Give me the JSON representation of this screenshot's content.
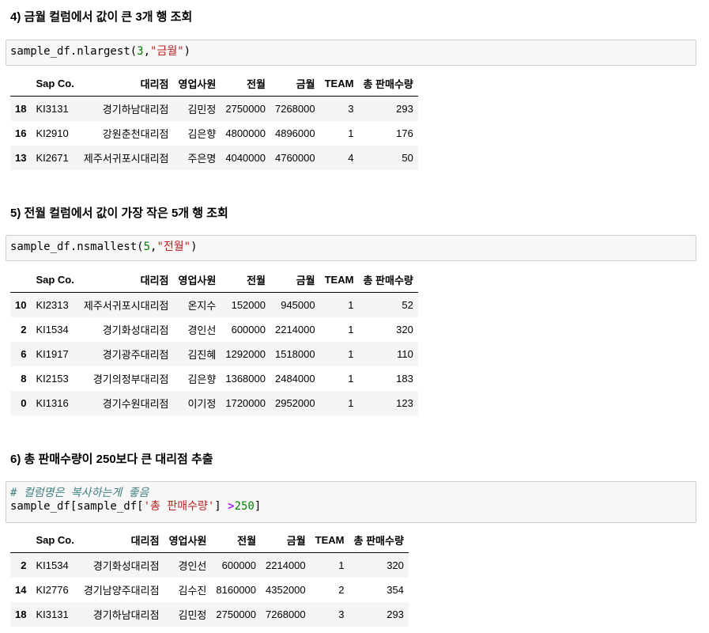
{
  "columns": [
    "",
    "Sap Co.",
    "대리점",
    "영업사원",
    "전월",
    "금월",
    "TEAM",
    "총 판매수량"
  ],
  "sections": [
    {
      "heading": "4) 금월 컬럼에서 값이 큰 3개 행 조회",
      "code": {
        "fn": "sample_df.nlargest(",
        "num": "3",
        "sep": ",",
        "str": "\"금월\"",
        "end": ")"
      },
      "rows": [
        [
          "18",
          "KI3131",
          "경기하남대리점",
          "김민정",
          "2750000",
          "7268000",
          "3",
          "293"
        ],
        [
          "16",
          "KI2910",
          "강원춘천대리점",
          "김은향",
          "4800000",
          "4896000",
          "1",
          "176"
        ],
        [
          "13",
          "KI2671",
          "제주서귀포시대리점",
          "주은명",
          "4040000",
          "4760000",
          "4",
          "50"
        ]
      ]
    },
    {
      "heading": "5) 전월 컬럼에서 값이 가장 작은 5개 행 조회",
      "code": {
        "fn": "sample_df.nsmallest(",
        "num": "5",
        "sep": ",",
        "str": "\"전월\"",
        "end": ")"
      },
      "rows": [
        [
          "10",
          "KI2313",
          "제주서귀포시대리점",
          "온지수",
          "152000",
          "945000",
          "1",
          "52"
        ],
        [
          "2",
          "KI1534",
          "경기화성대리점",
          "경인선",
          "600000",
          "2214000",
          "1",
          "320"
        ],
        [
          "6",
          "KI1917",
          "경기광주대리점",
          "김진혜",
          "1292000",
          "1518000",
          "1",
          "110"
        ],
        [
          "8",
          "KI2153",
          "경기의정부대리점",
          "김은향",
          "1368000",
          "2484000",
          "1",
          "183"
        ],
        [
          "0",
          "KI1316",
          "경기수원대리점",
          "이기정",
          "1720000",
          "2952000",
          "1",
          "123"
        ]
      ]
    },
    {
      "heading": "6) 총 판매수량이 250보다 큰 대리점 추출",
      "code": {
        "comment": "# 컬럼명은 복사하는게 좋음",
        "pre": "sample_df[sample_df[",
        "str": "'총 판매수량'",
        "mid": "] ",
        "op": ">",
        "num": "250",
        "end": "]"
      },
      "rows": [
        [
          "2",
          "KI1534",
          "경기화성대리점",
          "경인선",
          "600000",
          "2214000",
          "1",
          "320"
        ],
        [
          "14",
          "KI2776",
          "경기남양주대리점",
          "김수진",
          "8160000",
          "4352000",
          "2",
          "354"
        ],
        [
          "18",
          "KI3131",
          "경기하남대리점",
          "김민정",
          "2750000",
          "7268000",
          "3",
          "293"
        ]
      ]
    }
  ]
}
